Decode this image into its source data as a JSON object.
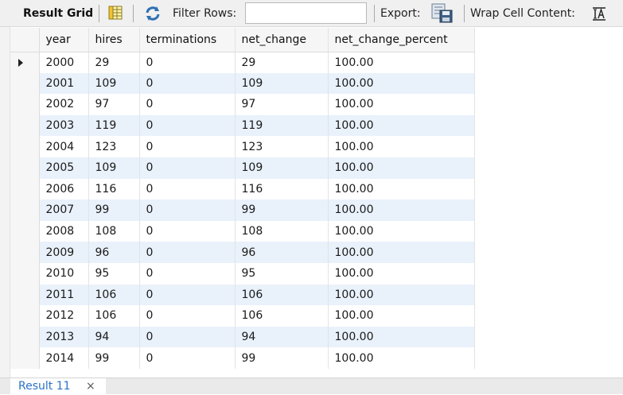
{
  "toolbar": {
    "result_grid_label": "Result Grid",
    "filter_rows_label": "Filter Rows:",
    "filter_rows_value": "",
    "export_label": "Export:",
    "wrap_label": "Wrap Cell Content:",
    "wrap_icon_text": "IA"
  },
  "grid": {
    "columns": [
      "year",
      "hires",
      "terminations",
      "net_change",
      "net_change_percent"
    ],
    "rows": [
      [
        "2000",
        "29",
        "0",
        "29",
        "100.00"
      ],
      [
        "2001",
        "109",
        "0",
        "109",
        "100.00"
      ],
      [
        "2002",
        "97",
        "0",
        "97",
        "100.00"
      ],
      [
        "2003",
        "119",
        "0",
        "119",
        "100.00"
      ],
      [
        "2004",
        "123",
        "0",
        "123",
        "100.00"
      ],
      [
        "2005",
        "109",
        "0",
        "109",
        "100.00"
      ],
      [
        "2006",
        "116",
        "0",
        "116",
        "100.00"
      ],
      [
        "2007",
        "99",
        "0",
        "99",
        "100.00"
      ],
      [
        "2008",
        "108",
        "0",
        "108",
        "100.00"
      ],
      [
        "2009",
        "96",
        "0",
        "96",
        "100.00"
      ],
      [
        "2010",
        "95",
        "0",
        "95",
        "100.00"
      ],
      [
        "2011",
        "106",
        "0",
        "106",
        "100.00"
      ],
      [
        "2012",
        "106",
        "0",
        "106",
        "100.00"
      ],
      [
        "2013",
        "94",
        "0",
        "94",
        "100.00"
      ],
      [
        "2014",
        "99",
        "0",
        "99",
        "100.00"
      ]
    ],
    "selected_row": 0
  },
  "tabs": [
    {
      "label": "Result 11",
      "close": "×"
    }
  ],
  "colors": {
    "alt_row": "#e9f1fb",
    "tab_label": "#2b73c6"
  }
}
